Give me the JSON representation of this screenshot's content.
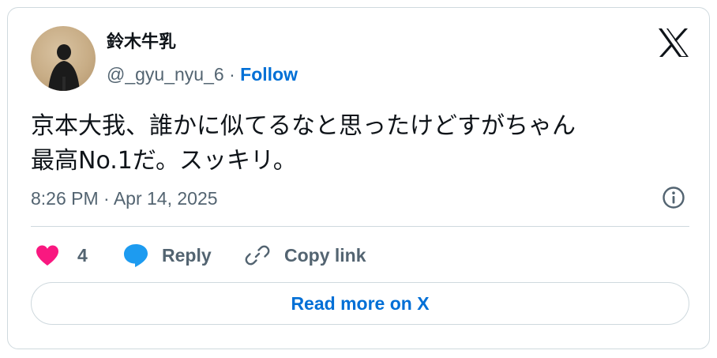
{
  "author": {
    "name": "鈴木牛乳",
    "handle": "@_gyu_nyu_6",
    "separator": "·",
    "follow_label": "Follow"
  },
  "tweet": {
    "lines": [
      "京本大我、誰かに似てるなと思ったけどすがちゃん",
      "最高No.1だ。スッキリ。"
    ],
    "timestamp": "8:26 PM · Apr 14, 2025"
  },
  "actions": {
    "like_count": "4",
    "reply_label": "Reply",
    "copy_link_label": "Copy link"
  },
  "read_more_label": "Read more on X",
  "icons": {
    "logo": "x-logo-icon",
    "info": "info-icon",
    "like": "heart-icon",
    "reply": "speech-bubble-icon",
    "copy": "link-icon"
  },
  "colors": {
    "like": "#f91880",
    "reply": "#1d9bf0",
    "link": "#006fd6",
    "muted": "#536471",
    "border": "#cfd9de"
  }
}
